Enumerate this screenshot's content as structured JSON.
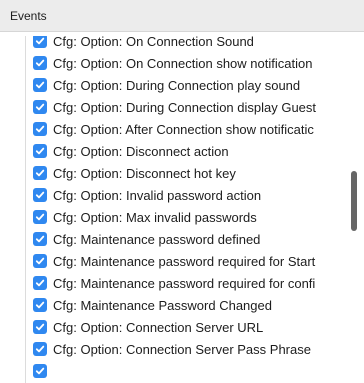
{
  "header": {
    "title": "Events"
  },
  "events": [
    {
      "label": "Cfg: Option: On Connection Sound",
      "checked": true
    },
    {
      "label": "Cfg: Option: On Connection show notification",
      "checked": true
    },
    {
      "label": "Cfg: Option: During Connection play sound",
      "checked": true
    },
    {
      "label": "Cfg: Option: During Connection display Guest",
      "checked": true
    },
    {
      "label": "Cfg: Option: After Connection show notificatic",
      "checked": true
    },
    {
      "label": "Cfg: Option: Disconnect action",
      "checked": true
    },
    {
      "label": "Cfg: Option: Disconnect hot key",
      "checked": true
    },
    {
      "label": "Cfg: Option: Invalid password action",
      "checked": true
    },
    {
      "label": "Cfg: Option: Max invalid passwords",
      "checked": true
    },
    {
      "label": "Cfg: Maintenance password defined",
      "checked": true
    },
    {
      "label": "Cfg: Maintenance password required for Start",
      "checked": true
    },
    {
      "label": "Cfg: Maintenance password required for confi",
      "checked": true
    },
    {
      "label": "Cfg: Maintenance Password Changed",
      "checked": true
    },
    {
      "label": "Cfg: Option: Connection Server URL",
      "checked": true
    },
    {
      "label": "Cfg: Option: Connection Server Pass Phrase",
      "checked": true
    },
    {
      "label": "",
      "checked": true
    }
  ],
  "colors": {
    "checkbox": "#2f88f0",
    "header_bg": "#ececec",
    "scroll_thumb": "#666666"
  }
}
